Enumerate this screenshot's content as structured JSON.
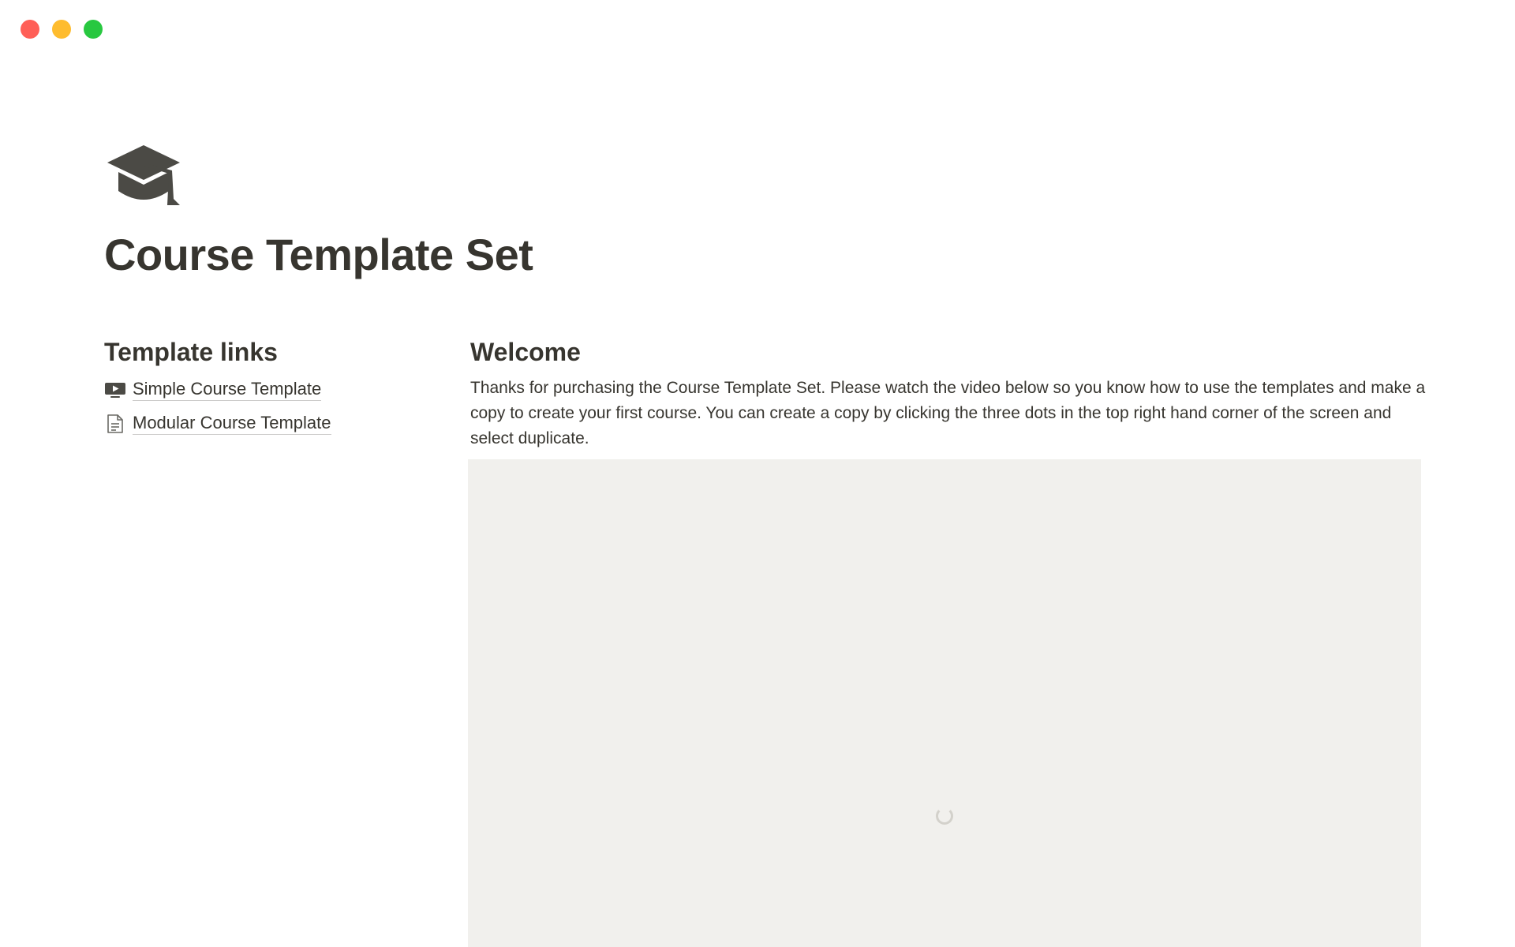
{
  "window": {
    "controls": [
      "close",
      "minimize",
      "maximize"
    ]
  },
  "page": {
    "icon": "graduation-cap-icon",
    "title": "Course Template Set"
  },
  "template_links": {
    "heading": "Template links",
    "items": [
      {
        "label": "Simple Course Template",
        "icon": "video-page-icon"
      },
      {
        "label": "Modular Course Template",
        "icon": "document-page-icon"
      }
    ]
  },
  "welcome": {
    "heading": "Welcome",
    "body": "Thanks for purchasing the Course Template Set. Please watch the video below so you know how to use the templates and make a copy to create your first course. You can create a copy by clicking the three dots in the top right hand corner of the screen and select duplicate."
  },
  "video": {
    "state": "loading"
  },
  "colors": {
    "text": "#37352f",
    "embed_background": "#f1f0ed",
    "close": "#ff5f57",
    "minimize": "#febc2e",
    "maximize": "#28c840"
  }
}
